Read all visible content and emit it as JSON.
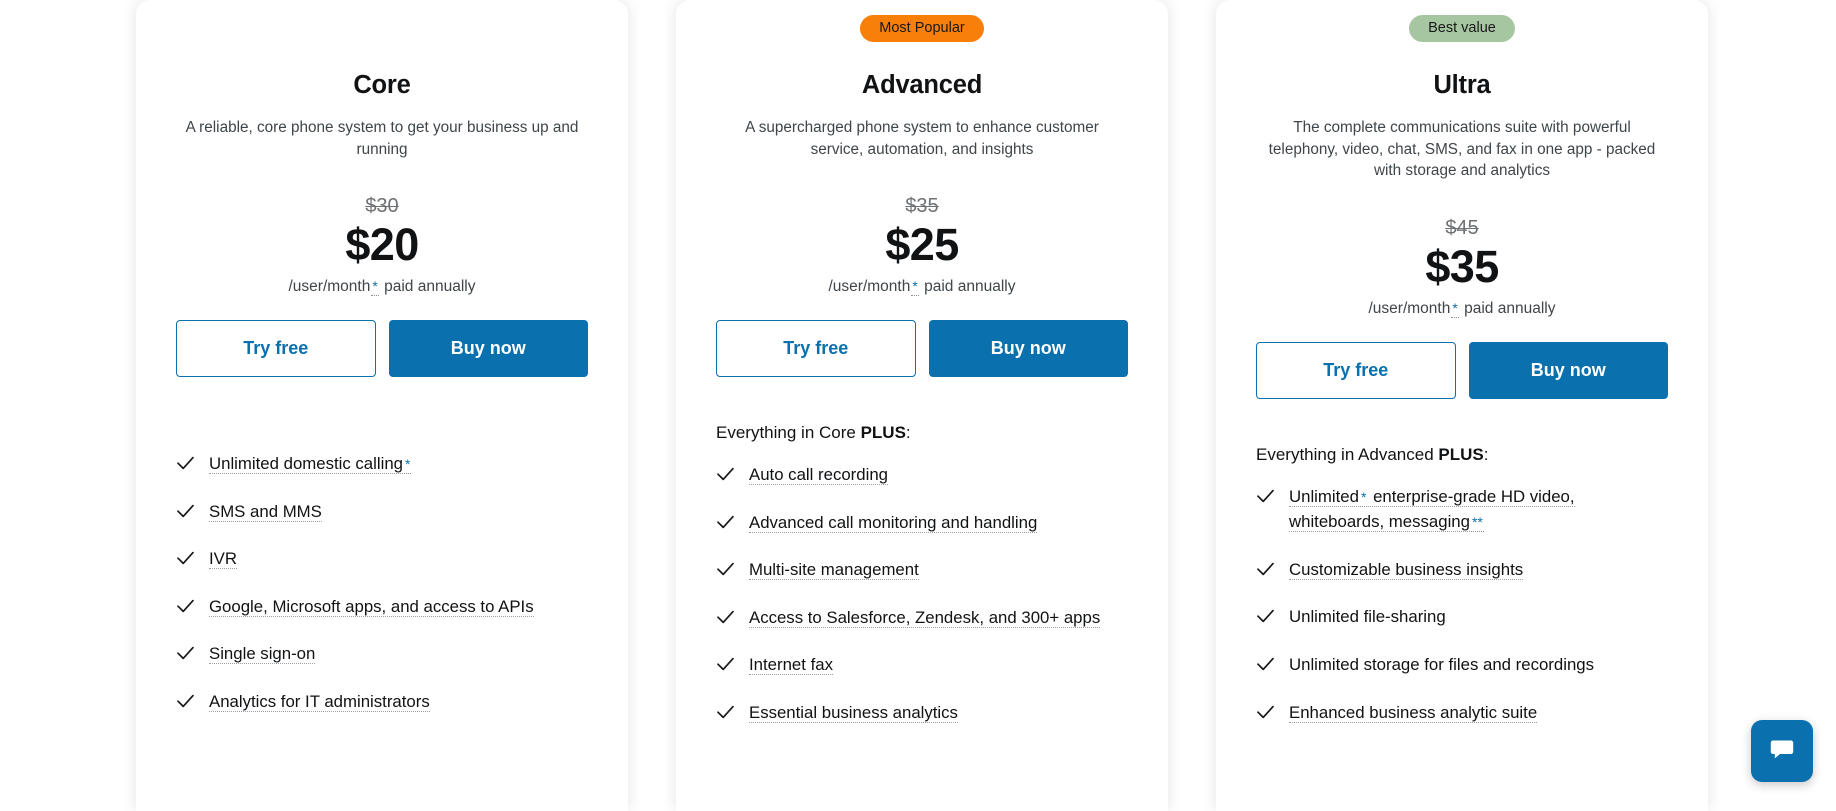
{
  "page": {
    "accent_blue": "#0B70AE",
    "badge_orange": "#F97F0B",
    "badge_green": "#A5C6A1",
    "text_dark": "#101214",
    "text_muted": "#3f4549"
  },
  "plans": [
    {
      "id": "core",
      "badge": null,
      "name": "Core",
      "description": "A reliable, core phone system to get your business up and running",
      "price_original": "$30",
      "price_current": "$20",
      "terms_prefix": "/user/month",
      "terms_asterisk": "*",
      "terms_suffix": " paid annually",
      "try_label": "Try free",
      "buy_label": "Buy now",
      "includes_prefix": null,
      "includes_bold": null,
      "includes_suffix": null,
      "features": [
        {
          "text": "Unlimited domestic calling",
          "asterisk": "*",
          "dotted": true
        },
        {
          "text": "SMS and MMS",
          "asterisk": "",
          "dotted": true
        },
        {
          "text": "IVR",
          "asterisk": "",
          "dotted": true
        },
        {
          "text": "Google, Microsoft apps, and access to APIs",
          "asterisk": "",
          "dotted": true
        },
        {
          "text": "Single sign-on",
          "asterisk": "",
          "dotted": true
        },
        {
          "text": "Analytics for IT administrators",
          "asterisk": "",
          "dotted": true
        }
      ]
    },
    {
      "id": "advanced",
      "badge": "Most Popular",
      "badge_style": "popular",
      "name": "Advanced",
      "description": "A supercharged phone system to enhance customer service, automation, and insights",
      "price_original": "$35",
      "price_current": "$25",
      "terms_prefix": "/user/month",
      "terms_asterisk": "*",
      "terms_suffix": " paid annually",
      "try_label": "Try free",
      "buy_label": "Buy now",
      "includes_prefix": "Everything in Core ",
      "includes_bold": "PLUS",
      "includes_suffix": ":",
      "features": [
        {
          "text": "Auto call recording",
          "asterisk": "",
          "dotted": true
        },
        {
          "text": "Advanced call monitoring and handling",
          "asterisk": "",
          "dotted": true
        },
        {
          "text": "Multi-site management",
          "asterisk": "",
          "dotted": true
        },
        {
          "text": "Access to Salesforce, Zendesk, and 300+ apps",
          "asterisk": "",
          "dotted": true
        },
        {
          "text": "Internet fax",
          "asterisk": "",
          "dotted": true
        },
        {
          "text": "Essential business analytics",
          "asterisk": "",
          "dotted": true
        }
      ]
    },
    {
      "id": "ultra",
      "badge": "Best value",
      "badge_style": "value",
      "name": "Ultra",
      "description": "The complete communications suite with powerful telephony, video, chat, SMS, and fax in one app - packed with storage and analytics",
      "price_original": "$45",
      "price_current": "$35",
      "terms_prefix": "/user/month",
      "terms_asterisk": "*",
      "terms_suffix": " paid annually",
      "try_label": "Try free",
      "buy_label": "Buy now",
      "includes_prefix": "Everything in Advanced ",
      "includes_bold": "PLUS",
      "includes_suffix": ":",
      "features": [
        {
          "text": "Unlimited* enterprise-grade HD video, whiteboards, messaging",
          "asterisk": "**",
          "dotted": true
        },
        {
          "text": "Customizable business insights",
          "asterisk": "",
          "dotted": true
        },
        {
          "text": "Unlimited file-sharing",
          "asterisk": "",
          "dotted": false
        },
        {
          "text": "Unlimited storage for files and recordings",
          "asterisk": "",
          "dotted": false
        },
        {
          "text": "Enhanced business analytic suite",
          "asterisk": "",
          "dotted": true
        }
      ]
    }
  ],
  "chat_widget": {
    "icon": "chat-bubble-icon",
    "color": "#0B70AE"
  }
}
